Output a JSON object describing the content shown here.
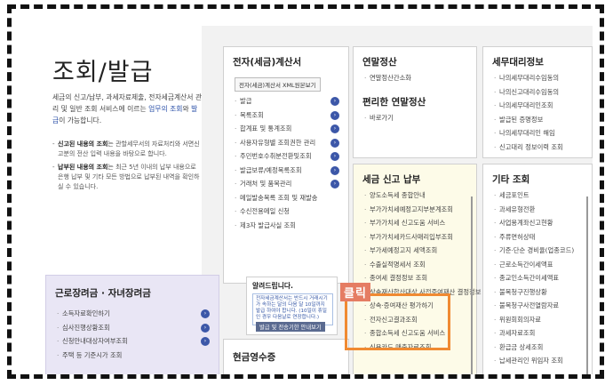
{
  "intro": {
    "title": "조회/발급",
    "desc_before": "세금의 신고/납부, 과세자료제출, 전자세금계산서 관리 및 일반 조회 서비스에 이르는 ",
    "desc_hl1": "업무의 조회",
    "desc_mid": "와 ",
    "desc_hl2": "발급",
    "desc_after": "이 가능합니다.",
    "note1_bold": "신고된 내용의 조회",
    "note1_text": "는 관할세무서의 자료처리와 서면신고분의 전산 입력 내용을 바탕으로 합니다.",
    "note2_bold": "납부된 내용의 조회",
    "note2_text": "는 최근 5년 이내의 납부 내용으로 은행 납부 및 기타 모든 방법으로 납부된 내역을 확인하실 수 있습니다."
  },
  "etax": {
    "title": "전자(세금)계산서",
    "button": "전자(세금)계산서 XML원본보기",
    "items": [
      "발급",
      "목록조회",
      "합계표 및 통계조회",
      "사용자유형별 조회권한 관리",
      "주민번호수취분전환및조회",
      "발급보류/예정목록조회",
      "거래처 및 품목관리",
      "메일발송목록 조회 및 재발송",
      "수신전용메일 신청",
      "제3자 발급사실 조회"
    ]
  },
  "yearend": {
    "title": "연말정산",
    "items": [
      "연말정산간소화"
    ],
    "sub_title": "편리한 연말정산",
    "sub_items": [
      "바로가기"
    ]
  },
  "agent": {
    "title": "세무대리정보",
    "items": [
      "나의세무대리수임동의",
      "나의신고대리수임동의",
      "나의세무대리인조회",
      "발급된 증명정보",
      "나의세무대리인 해임",
      "신고대리 정보이력 조회"
    ]
  },
  "report": {
    "title": "세금 신고 납부",
    "items": [
      "양도소득세 종합안내",
      "부가가치세예정고지부분계조회",
      "부가가치세 신고도움 서비스",
      "부가가치세카드사매리입부조회",
      "부가세예정고지 세액조회",
      "수출실적명세서 조회",
      "종여세 결정정보 조회",
      "상속재산합산대상 사전증여재산 결정정보 조회",
      "상속·증여재산 평가하기",
      "전자신고결과조회",
      "종합소득세 신고도움 서비스",
      "신용카드 매출자료조회"
    ]
  },
  "other": {
    "title": "기타 조회",
    "items": [
      "세금포인트",
      "과세유형전환",
      "사업용계좌신고현황",
      "주류면허상태",
      "기준·단순 경비율(업종코드)",
      "근로소득간이세액표",
      "종교인소득간이세액표",
      "불복청구진행상황",
      "불복청구사전열람자료",
      "위원회회의자료",
      "과세자료조회",
      "환급금 상세조회",
      "납세관리인 위임자 조회"
    ]
  },
  "labor": {
    "title": "근로장려금 · 자녀장려금",
    "items": [
      "소득자료확인하기",
      "심사진행상황조회",
      "신청안내대상자여부조회",
      "주택 등 기준시가 조회"
    ]
  },
  "alert": {
    "title": "알려드립니다.",
    "body": "전자세금계산서는 반드시 거래시기가 속하는 달의 다음 달 10일까지 발급 하여야 합니다. (10일이 휴일인 경우 다음날로 연장합니다.)",
    "button": "발급 및 전송기한 안내보기"
  },
  "cash": {
    "title": "현금영수증"
  },
  "overlay": {
    "click_label": "클릭"
  },
  "colors": {
    "highlight": "#f08a32",
    "accent": "#2b50a8",
    "arrow": "#3c57a8"
  }
}
